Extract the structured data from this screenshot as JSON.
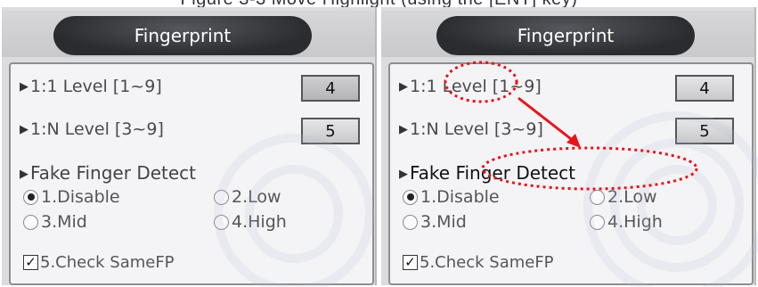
{
  "caption": "Figure 3-3 Move Highlight (using the [ENT] key)",
  "screens": [
    {
      "title": "Fingerprint",
      "level_11_label": "1:1 Level [1~9]",
      "level_11_value": "4",
      "level_1n_label": "1:N Level [3~9]",
      "level_1n_value": "5",
      "fake_detect_title": "Fake Finger Detect",
      "options": [
        "1.Disable",
        "2.Low",
        "3.Mid",
        "4.High"
      ],
      "selected_option": "1.Disable",
      "check_label": "5.Check SameFP",
      "check_mark": "✓"
    },
    {
      "title": "Fingerprint",
      "level_11_label": "1:1 Level [1~9]",
      "level_11_value": "4",
      "level_1n_label": "1:N Level [3~9]",
      "level_1n_value": "5",
      "fake_detect_title": "Fake Finger Detect",
      "options": [
        "1.Disable",
        "2.Low",
        "3.Mid",
        "4.High"
      ],
      "selected_option": "1.Disable",
      "check_label": "5.Check SameFP",
      "check_mark": "✓"
    }
  ],
  "annotation_color": "#e8141b",
  "icons": {
    "arrow": "play-arrow-icon",
    "radio": "radio-icon",
    "check": "checkbox-icon"
  }
}
